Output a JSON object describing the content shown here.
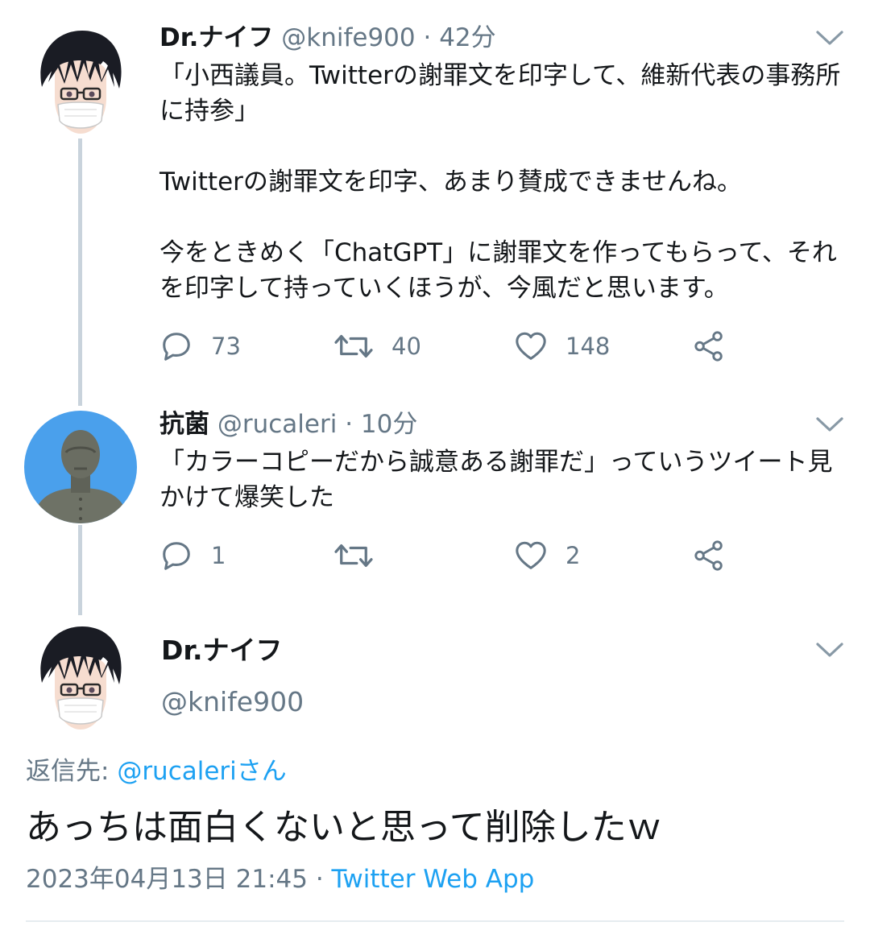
{
  "thread": [
    {
      "avatar_icon": "anime-man-glasses-mask-avatar",
      "name": "Dr.ナイフ",
      "handle": "@knife900",
      "separator": "·",
      "time": "42分",
      "paragraphs": [
        "「小西議員。Twitterの謝罪文を印字して、維新代表の事務所に持参」",
        "Twitterの謝罪文を印字、あまり賛成できませんね。",
        "今をときめく「ChatGPT」に謝罪文を作ってもらって、それを印字して持っていくほうが、今風だと思います。"
      ],
      "replies": "73",
      "retweets": "40",
      "likes": "148"
    },
    {
      "avatar_icon": "bronze-statue-avatar",
      "name": "抗菌",
      "handle": "@rucaleri",
      "separator": "·",
      "time": "10分",
      "paragraphs": [
        "「カラーコピーだから誠意ある謝罪だ」っていうツイート見かけて爆笑した"
      ],
      "replies": "1",
      "retweets": "",
      "likes": "2"
    }
  ],
  "main_tweet": {
    "avatar_icon": "anime-man-glasses-mask-avatar",
    "name": "Dr.ナイフ",
    "handle": "@knife900",
    "reply_to_label": "返信先: ",
    "reply_to_user": "@rucaleriさん",
    "text": "あっちは面白くないと思って削除したｗ",
    "timestamp": "2023年04月13日 21:45",
    "separator": " · ",
    "source": "Twitter Web App"
  },
  "colors": {
    "link": "#1da1f2",
    "muted": "#657786",
    "thread_line": "#c9d3dc"
  }
}
